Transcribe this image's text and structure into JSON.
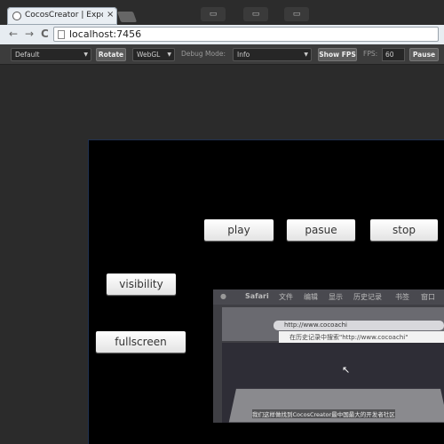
{
  "browser": {
    "tab_title": "CocosCreator | Expo",
    "tab_close": "×",
    "win_ctl_1": "▭",
    "win_ctl_2": "▭",
    "win_ctl_3": "▭",
    "back": "←",
    "forward": "→",
    "reload": "C",
    "url": "localhost:7456"
  },
  "toolbar": {
    "device": "Default",
    "rotate": "Rotate",
    "renderer": "WebGL",
    "debug_label": "Debug Mode:",
    "debug_value": "Info",
    "show_fps": "Show FPS",
    "fps_label": "FPS:",
    "fps_value": "60",
    "pause": "Pause"
  },
  "scene": {
    "play": "play",
    "pause": "pasue",
    "stop": "stop",
    "visibility": "visibility",
    "fullscreen": "fullscreen"
  },
  "video": {
    "menu": [
      "Safari",
      "文件",
      "编辑",
      "显示",
      "历史记录",
      "书签",
      "窗口"
    ],
    "address": "http://www.cocoachi",
    "suggestion": "在历史记录中搜索\"http://www.cocoachi\"",
    "subtitle": "我们这样做找到CocosCreator最中国最大的开发者社区"
  }
}
